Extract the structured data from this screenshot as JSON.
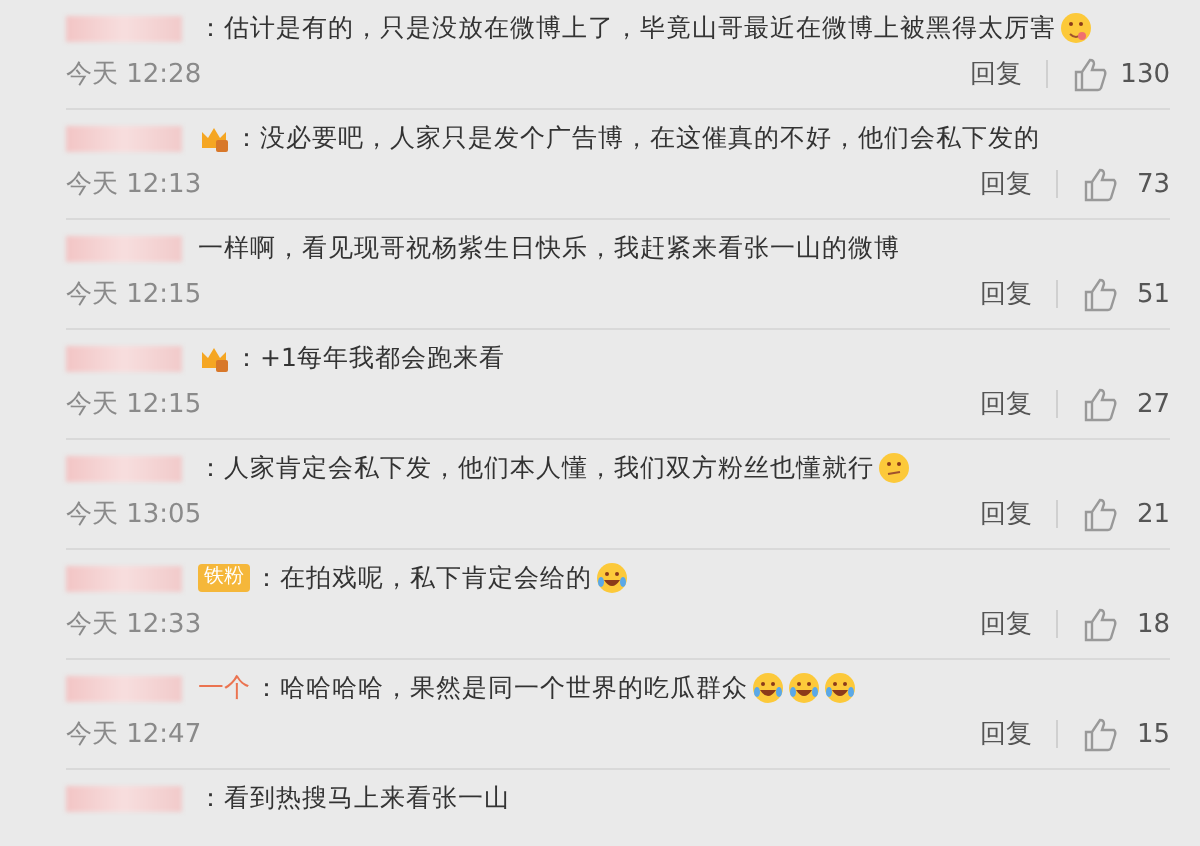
{
  "comments": [
    {
      "text": "：估计是有的，只是没放在微博上了，毕竟山哥最近在微博上被黑得太厉害",
      "emoji": [
        {
          "kind": "yum"
        }
      ],
      "time": "今天 12:28",
      "reply": "回复",
      "likes": "130"
    },
    {
      "badge": {
        "kind": "vip"
      },
      "text": "：没必要吧，人家只是发个广告博，在这催真的不好，他们会私下发的",
      "time": "今天 12:13",
      "reply": "回复",
      "likes": "73"
    },
    {
      "text": "一样啊，看见现哥祝杨紫生日快乐，我赶紧来看张一山的微博",
      "time": "今天 12:15",
      "reply": "回复",
      "likes": "51"
    },
    {
      "badge": {
        "kind": "vip"
      },
      "text": "：+1每年我都会跑来看",
      "time": "今天 12:15",
      "reply": "回复",
      "likes": "27"
    },
    {
      "text": "：人家肯定会私下发，他们本人懂，我们双方粉丝也懂就行",
      "emoji": [
        {
          "kind": "smirk"
        }
      ],
      "time": "今天 13:05",
      "reply": "回复",
      "likes": "21"
    },
    {
      "badge": {
        "kind": "fan",
        "label": "铁粉"
      },
      "text": "：在拍戏呢，私下肯定会给的",
      "emoji": [
        {
          "kind": "laugh-cry"
        }
      ],
      "time": "今天 12:33",
      "reply": "回复",
      "likes": "18"
    },
    {
      "name_tail": "一个",
      "text": "：哈哈哈哈，果然是同一个世界的吃瓜群众",
      "emoji": [
        {
          "kind": "laugh-cry"
        },
        {
          "kind": "laugh-cry"
        },
        {
          "kind": "laugh-cry"
        }
      ],
      "time": "今天 12:47",
      "reply": "回复",
      "likes": "15"
    },
    {
      "text": "：看到热搜马上来看张一山"
    }
  ]
}
